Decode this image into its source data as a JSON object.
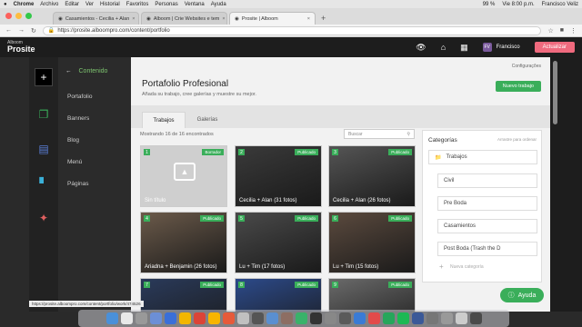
{
  "macbar": {
    "app": "Chrome",
    "menus": [
      "Archivo",
      "Editar",
      "Ver",
      "Historial",
      "Favoritos",
      "Personas",
      "Ventana",
      "Ayuda"
    ],
    "battery": "99 %",
    "clock": "Vie 8:00 p.m.",
    "user": "Francisco Veliz"
  },
  "tabs": [
    {
      "label": "Casamientos - Cecilia + Alan",
      "active": false
    },
    {
      "label": "Alboom | Crie Websites e tem",
      "active": false
    },
    {
      "label": "Prosite | Alboom",
      "active": true
    }
  ],
  "address": {
    "url": "https://prosite.alboompro.com/content/portfolio"
  },
  "topnav": {
    "logo_small": "Alboom",
    "logo_big": "Prosite",
    "user_initials": "FV",
    "user_name": "Francisco",
    "upgrade_label": "Actualizar"
  },
  "submenu": {
    "title": "Contenido",
    "items": [
      "Portafolio",
      "Banners",
      "Blog",
      "Menú",
      "Páginas"
    ]
  },
  "page": {
    "title": "Portafolio Profesional",
    "subtitle": "Añada su trabajo, cree galerías y muestre su mejor.",
    "config_label": "Configurações",
    "new_button": "Nuevo trabajo",
    "tabs": [
      "Trabajos",
      "Galerías"
    ],
    "count": "Mostrando 16 de 16 encontrados",
    "search_placeholder": "Buscar"
  },
  "cards": [
    {
      "num": "1",
      "badge": "Borrador",
      "caption": "Sin título",
      "bg": "#cfcfcf",
      "placeholder": true
    },
    {
      "num": "2",
      "badge": "Publicado",
      "caption": "Cecilia + Alan (31 fotos)",
      "bg": "#3a3a3a"
    },
    {
      "num": "3",
      "badge": "Publicado",
      "caption": "Cecilia + Alan (26 fotos)",
      "bg": "#555"
    },
    {
      "num": "4",
      "badge": "Publicado",
      "caption": "Ariadna + Benjamin (26 fotos)",
      "bg": "#6b5a4a"
    },
    {
      "num": "5",
      "badge": "Publicado",
      "caption": "Lu + Tim (17 fotos)",
      "bg": "#4a4a4a"
    },
    {
      "num": "6",
      "badge": "Publicado",
      "caption": "Lu + Tim (15 fotos)",
      "bg": "#5b4a3e"
    },
    {
      "num": "7",
      "badge": "Publicado",
      "caption": "",
      "bg": "#2a3a5a"
    },
    {
      "num": "8",
      "badge": "Publicado",
      "caption": "",
      "bg": "#2c4a8a"
    },
    {
      "num": "9",
      "badge": "Publicado",
      "caption": "",
      "bg": "#6a6a6a"
    }
  ],
  "categories": {
    "title": "Categorías",
    "hint": "Arrastre para ordenar",
    "root": "Trabajos",
    "items": [
      "Civil",
      "Pre Boda",
      "Casamientos",
      "Post Boda (Trash the D"
    ],
    "add_label": "Nueva categoría"
  },
  "status_url": "https://prosite.alboompro.com/content/portfolio/work/474526",
  "help_label": "Ayuda",
  "dock_colors": [
    "#4a90d9",
    "#e8e8e8",
    "#999",
    "#6c8fd6",
    "#3a6fd8",
    "#f2b600",
    "#db4437",
    "#f7b500",
    "#e65a3a",
    "#c0c0c0",
    "#555",
    "#5a8fd0",
    "#8d6e63",
    "#3ab26a",
    "#333",
    "#888",
    "#5a5a5a",
    "#3a7bd5",
    "#e24a4a",
    "#26a65b",
    "#1db954",
    "#3b5998",
    "#777",
    "#999",
    "#ccc",
    "#4a4a4a"
  ]
}
